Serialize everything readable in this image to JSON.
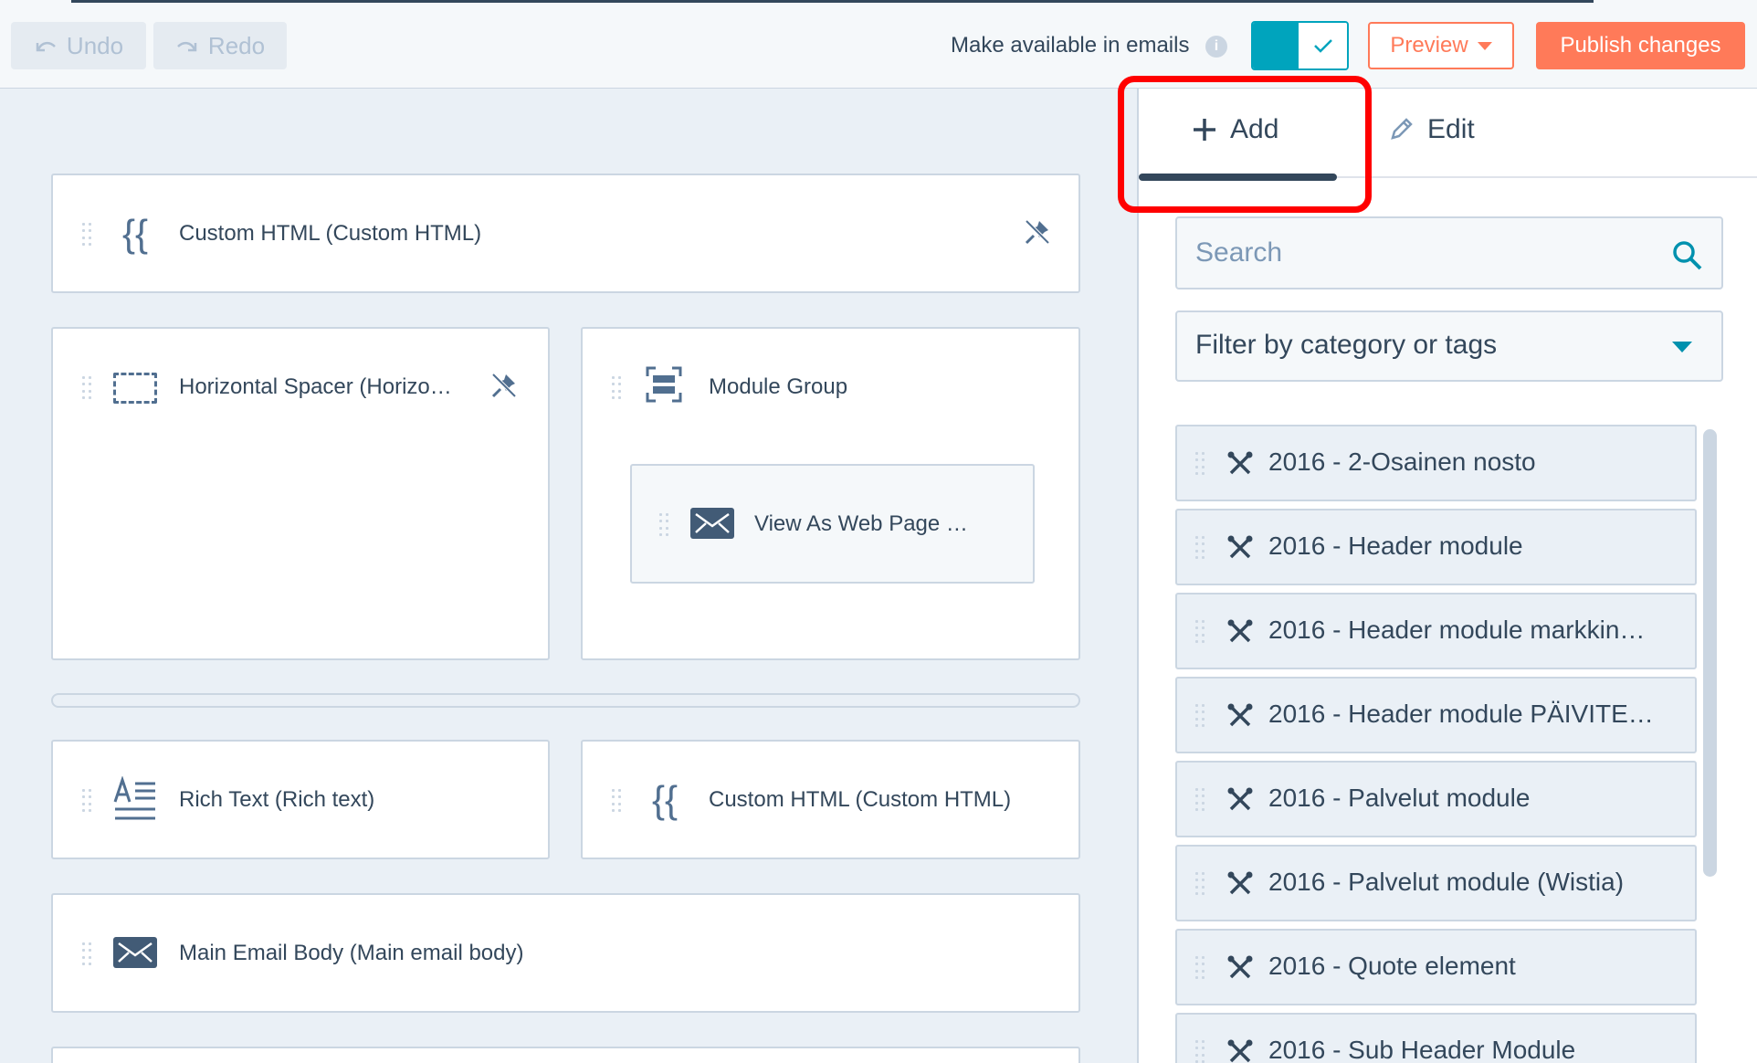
{
  "toolbar": {
    "undo_label": "Undo",
    "redo_label": "Redo",
    "emails_label": "Make available in emails",
    "info_glyph": "i",
    "preview_label": "Preview",
    "publish_label": "Publish changes"
  },
  "canvas": {
    "modules": {
      "custom_html_top": "Custom HTML (Custom HTML)",
      "horizontal_spacer": "Horizontal Spacer (Horizo…",
      "module_group": "Module Group",
      "view_as_web_page": "View As Web Page …",
      "rich_text": "Rich Text (Rich text)",
      "custom_html_right": "Custom HTML (Custom HTML)",
      "main_email_body": "Main Email Body (Main email body)"
    },
    "icons": {
      "curly": "{{"
    }
  },
  "sidebar": {
    "tab_add": "Add",
    "tab_edit": "Edit",
    "search_placeholder": "Search",
    "filter_label": "Filter by category or tags",
    "items": [
      "2016 - 2-Osainen nosto",
      "2016 - Header module",
      "2016 - Header module markkin…",
      "2016 - Header module PÄIVITE…",
      "2016 - Palvelut module",
      "2016 - Palvelut module (Wistia)",
      "2016 - Quote element",
      "2016 - Sub Header Module"
    ]
  },
  "colors": {
    "accent": "#ff7a59",
    "toggle": "#00a4bd",
    "text": "#33475b",
    "highlight": "#ff0000"
  }
}
